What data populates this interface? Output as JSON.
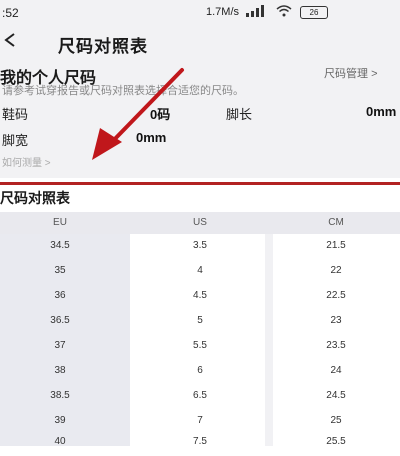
{
  "status_bar": {
    "time": ":52",
    "network_speed": "1.7M/s",
    "battery": "26"
  },
  "header": {
    "back_icon": "back-arrow-icon",
    "title": "尺码对照表"
  },
  "personal": {
    "heading": "我的个人尺码",
    "manage_label": "尺码管理",
    "manage_chevron": ">",
    "hint": "请参考试穿报告或尺码对照表选择合适您的尺码。",
    "shoe_size_label": "鞋码",
    "shoe_size_value": "0码",
    "foot_length_label": "脚长",
    "foot_length_value": "0mm",
    "foot_width_label": "脚宽",
    "foot_width_value": "0mm",
    "how_to_measure": "如何测量 >"
  },
  "chart_section": {
    "title": "尺码对照表"
  },
  "table": {
    "headers": [
      "EU",
      "US",
      "CM"
    ],
    "rows": [
      [
        "34.5",
        "3.5",
        "21.5"
      ],
      [
        "35",
        "4",
        "22"
      ],
      [
        "36",
        "4.5",
        "22.5"
      ],
      [
        "36.5",
        "5",
        "23"
      ],
      [
        "37",
        "5.5",
        "23.5"
      ],
      [
        "38",
        "6",
        "24"
      ],
      [
        "38.5",
        "6.5",
        "24.5"
      ],
      [
        "39",
        "7",
        "25"
      ],
      [
        "40",
        "7.5",
        "25.5"
      ]
    ]
  },
  "colors": {
    "accent_red": "#b22222",
    "background": "#f2f2f4"
  }
}
